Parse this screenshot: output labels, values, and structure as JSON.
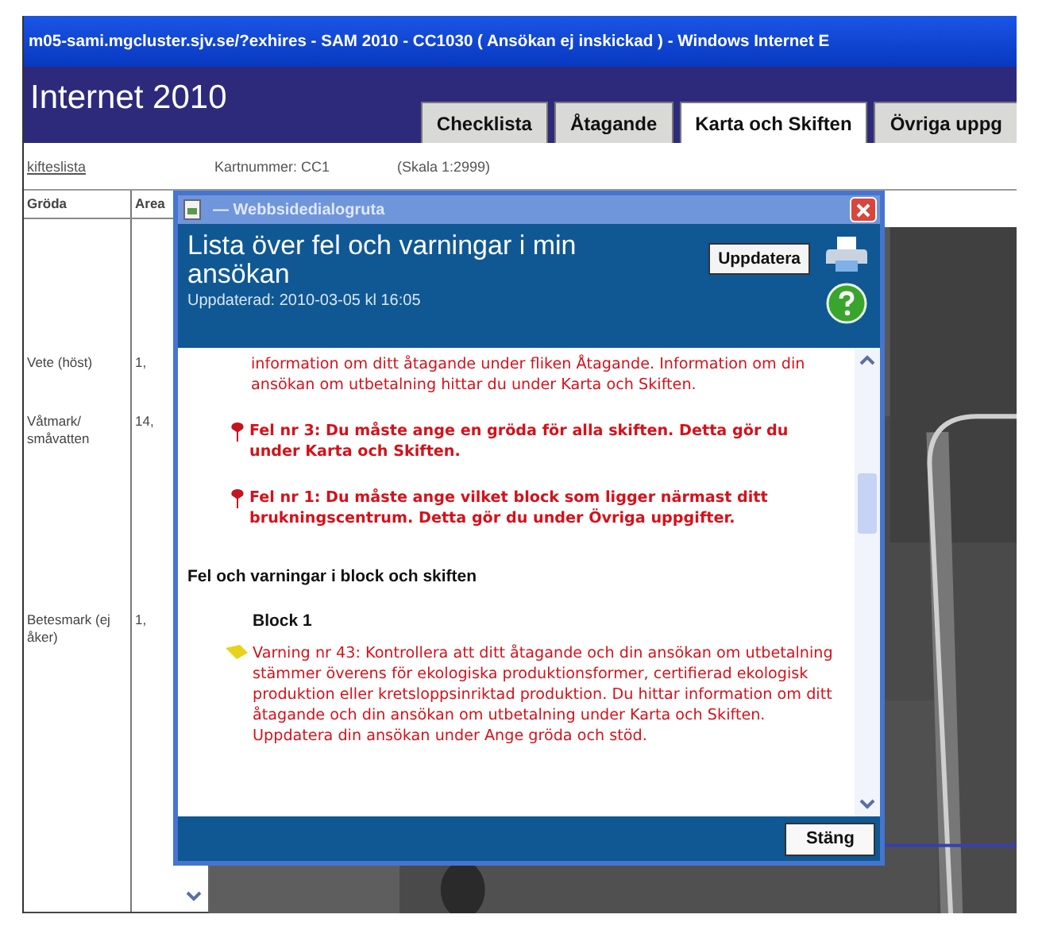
{
  "window": {
    "title": "m05-sami.mgcluster.sjv.se/?exhires - SAM 2010 - CC1030 ( Ansökan ej inskickad ) - Windows Internet E"
  },
  "header": {
    "title": "Internet 2010"
  },
  "tabs": [
    {
      "label": "Checklista",
      "selected": false
    },
    {
      "label": "Åtagande",
      "selected": false
    },
    {
      "label": "Karta och Skiften",
      "selected": true
    },
    {
      "label": "Övriga uppg",
      "selected": false
    }
  ],
  "subbar": {
    "link": "kifteslista",
    "map_number": "Kartnummer: CC1",
    "scale": "(Skala 1:2999)"
  },
  "crop_table": {
    "columns": [
      "Gröda",
      "Area"
    ],
    "rows": [
      {
        "crop": "Vete (höst)",
        "area": "1,"
      },
      {
        "crop": "Våtmark/ småvatten",
        "area": "14,"
      },
      {
        "crop": "Betesmark (ej åker)",
        "area": "1,"
      }
    ]
  },
  "dialog": {
    "title": "— Webbsidedialogruta",
    "heading": "Lista över fel och varningar i min ansökan",
    "updated": "Uppdaterad: 2010-03-05 kl 16:05",
    "update_button": "Uppdatera",
    "messages": [
      {
        "kind": "info",
        "text": "information om ditt åtagande under fliken Åtagande. Information om din ansökan om utbetalning hittar du under Karta och Skiften."
      },
      {
        "kind": "error",
        "text": "Fel nr 3: Du måste ange en gröda för alla skiften. Detta gör du under Karta och Skiften."
      },
      {
        "kind": "error",
        "text": "Fel nr 1: Du måste ange vilket block som ligger närmast ditt brukningscentrum. Detta gör du under Övriga uppgifter."
      }
    ],
    "section_heading": "Fel och varningar i block och skiften",
    "blocks": [
      {
        "title": "Block 1",
        "messages": [
          {
            "kind": "warning",
            "text": "Varning nr 43: Kontrollera att ditt åtagande och din ansökan om utbetalning stämmer överens för ekologiska produktionsformer, certifierad ekologisk produktion eller kretsloppsinriktad produktion. Du hittar information om ditt åtagande och din ansökan om utbetalning under Karta och Skiften. Uppdatera din ansökan under Ange gröda och stöd."
          }
        ]
      }
    ],
    "close_button": "Stäng"
  }
}
